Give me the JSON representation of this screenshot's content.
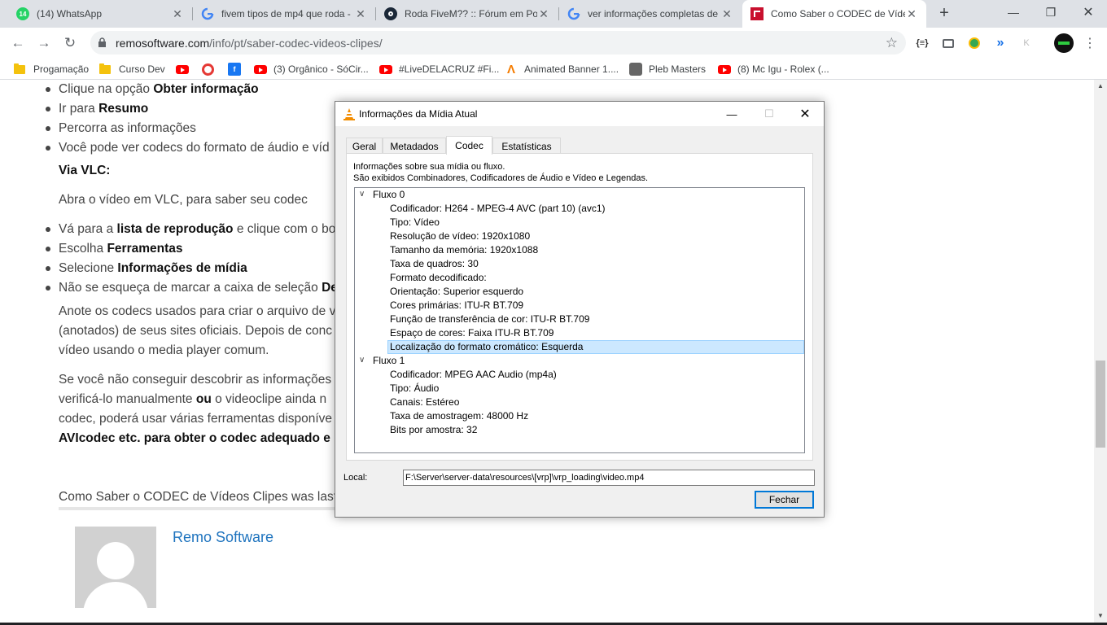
{
  "browser": {
    "tabs": [
      {
        "title": "(14) WhatsApp",
        "badge": "14",
        "icon": "whatsapp-icon"
      },
      {
        "title": "fivem tipos de mp4 que roda - ",
        "icon": "google-icon"
      },
      {
        "title": "Roda FiveM?? :: Fórum em Por",
        "icon": "steam-icon"
      },
      {
        "title": "ver informações completas de",
        "icon": "google-icon"
      },
      {
        "title": "Como Saber o CODEC de Víde",
        "icon": "remo-icon",
        "active": true
      }
    ],
    "url_domain": "remosoftware.com",
    "url_path": "/info/pt/saber-codec-videos-clipes/",
    "extensions": {
      "json_label": "{≡}",
      "kaspersky_label": "K"
    },
    "bookmarks": [
      {
        "label": "Progamação",
        "icon": "folder-icon"
      },
      {
        "label": "Curso Dev",
        "icon": "folder-icon"
      },
      {
        "label": "",
        "icon": "youtube-icon"
      },
      {
        "label": "",
        "icon": "opera-icon"
      },
      {
        "label": "",
        "icon": "facebook-icon"
      },
      {
        "label": "(3) Orgânico - SóCir...",
        "icon": "youtube-icon"
      },
      {
        "label": "#LiveDELACRUZ #Fi...",
        "icon": "youtube-icon"
      },
      {
        "label": "Animated Banner 1....",
        "icon": "banner-icon"
      },
      {
        "label": "Pleb Masters",
        "icon": "pleb-icon"
      },
      {
        "label": "(8) Mc Igu - Rolex (...",
        "icon": "youtube-icon"
      }
    ]
  },
  "page": {
    "list1": [
      {
        "pre": "Clique na opção ",
        "bold": "Obter informação",
        "post": ""
      },
      {
        "pre": "Ir para ",
        "bold": "Resumo",
        "post": ""
      },
      {
        "pre": "Percorra as informações",
        "bold": "",
        "post": ""
      },
      {
        "pre": "Você pode ver codecs do formato de áudio e víd",
        "bold": "",
        "post": ""
      }
    ],
    "via_vlc": "Via VLC:",
    "vlc_intro": "Abra o vídeo em VLC, para saber seu codec",
    "list2": [
      {
        "pre": "Vá para a ",
        "bold": "lista de reprodução",
        "post": " e clique com o bo"
      },
      {
        "pre": "Escolha ",
        "bold": "Ferramentas",
        "post": ""
      },
      {
        "pre": "Selecione ",
        "bold": "Informações de mídia",
        "post": ""
      },
      {
        "pre": "Não se esqueça de marcar a caixa de seleção ",
        "bold": "De",
        "post": ""
      }
    ],
    "para1": [
      "Anote os codecs usados para criar o arquivo de v",
      "(anotados) de seus sites oficiais. Depois de conc",
      "vídeo usando o media player comum."
    ],
    "para2_l1": "Se você não conseguir descobrir as informações",
    "para2_l2_pre": "verificá-lo manualmente ",
    "para2_l2_bold": "ou",
    "para2_l2_post": " o videoclipe ainda n",
    "para2_l3": "codec, poderá usar várias ferramentas disponíve",
    "para2_l4_bold": "AVIcodec etc. para obter o codec adequado e",
    "updated": "Como Saber o CODEC de Vídeos Clipes was last",
    "author": "Remo Software"
  },
  "vlc": {
    "title": "Informações da Mídia Atual",
    "tabs": [
      "Geral",
      "Metadados",
      "Codec",
      "Estatísticas"
    ],
    "active_tab": "Codec",
    "info_line1": "Informações sobre sua mídia ou fluxo.",
    "info_line2": "São exibidos Combinadores, Codificadores de Áudio e Vídeo e Legendas.",
    "streams": [
      {
        "name": "Fluxo 0",
        "props": [
          "Codificador: H264 - MPEG-4 AVC (part 10) (avc1)",
          "Tipo: Vídeo",
          "Resolução de vídeo: 1920x1080",
          "Tamanho da memória: 1920x1088",
          "Taxa de quadros: 30",
          "Formato decodificado:",
          "Orientação: Superior esquerdo",
          "Cores primárias: ITU-R BT.709",
          "Função de transferência de cor: ITU-R BT.709",
          "Espaço de cores: Faixa ITU-R BT.709",
          "Localização do formato cromático: Esquerda"
        ]
      },
      {
        "name": "Fluxo 1",
        "props": [
          "Codificador: MPEG AAC Audio (mp4a)",
          "Tipo: Áudio",
          "Canais: Estéreo",
          "Taxa de amostragem: 48000 Hz",
          "Bits por amostra: 32"
        ]
      }
    ],
    "selected_prop": "Localização do formato cromático: Esquerda",
    "location_label": "Local:",
    "location_value": "F:\\Server\\server-data\\resources\\[vrp]\\vrp_loading\\video.mp4",
    "close_label": "Fechar"
  }
}
